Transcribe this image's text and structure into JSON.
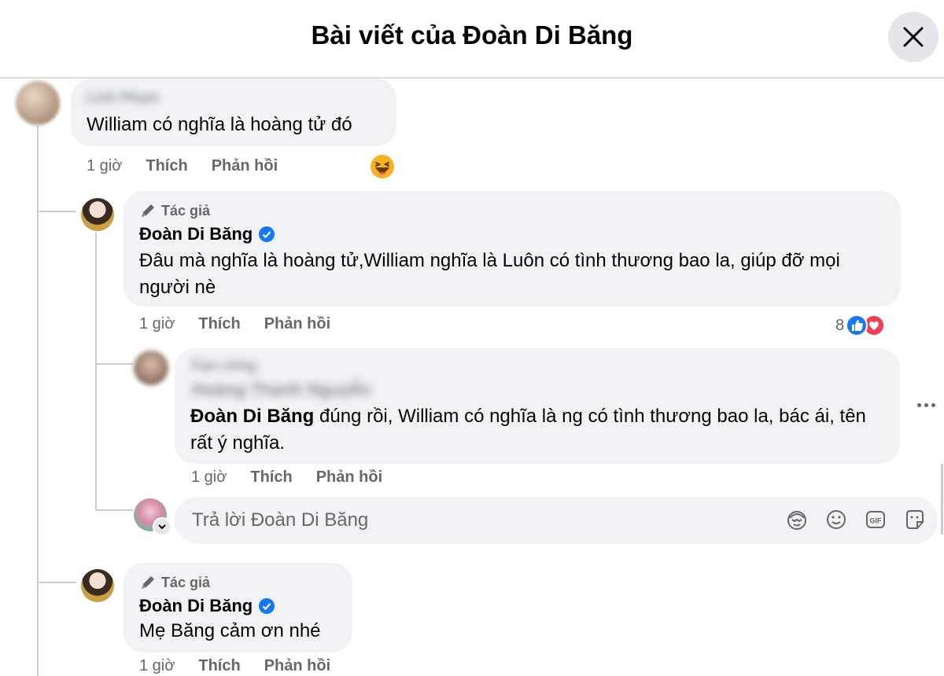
{
  "header": {
    "title": "Bài viết của Đoàn Di Băng"
  },
  "comments": {
    "c1": {
      "name": "Linh Phạm",
      "text": "William có nghĩa là hoàng tử đó",
      "time": "1 giờ",
      "like": "Thích",
      "reply": "Phản hồi"
    },
    "c2": {
      "author_badge": "Tác giả",
      "name": "Đoàn Di Băng",
      "text": "Đâu mà nghĩa là hoàng tử,William nghĩa là Luôn có tình thương bao la, giúp đỡ mọi người nè",
      "time": "1 giờ",
      "like": "Thích",
      "reply": "Phản hồi",
      "reaction_count": "8"
    },
    "c3": {
      "badge": "Fan cứng",
      "name": "Hoàng Thanh Nguyễn",
      "mention": "Đoàn Di Băng",
      "text": " đúng rồi, William có nghĩa là ng có tình thương bao la, bác ái, tên rất ý nghĩa.",
      "time": "1 giờ",
      "like": "Thích",
      "reply": "Phản hồi"
    },
    "c4": {
      "author_badge": "Tác giả",
      "name": "Đoàn Di Băng",
      "text": "Mẹ Băng cảm ơn nhé",
      "time": "1 giờ",
      "like": "Thích",
      "reply": "Phản hồi"
    }
  },
  "reply_input": {
    "placeholder": "Trả lời Đoàn Di Băng"
  },
  "colors": {
    "verified": "#1877f2",
    "like": "#1877f2",
    "love": "#f33e58",
    "bubble": "#f0f2f5"
  }
}
